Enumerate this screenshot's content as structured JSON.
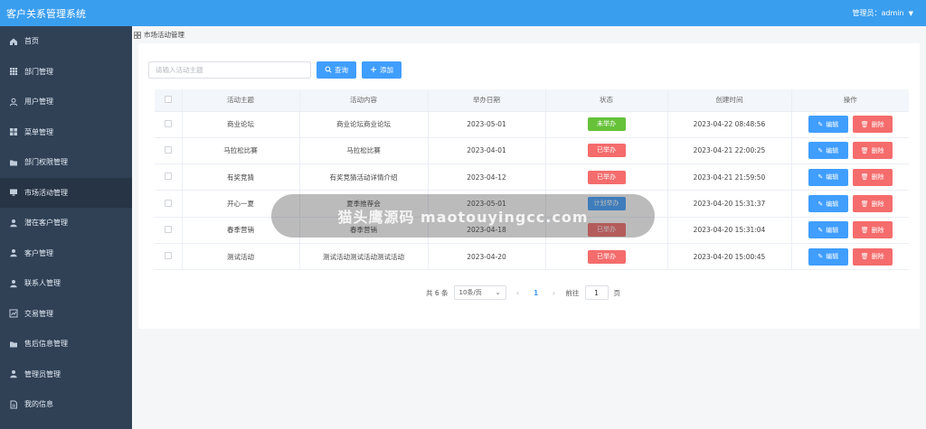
{
  "app": {
    "title": "客户关系管理系统",
    "admin_label": "管理员：admin"
  },
  "sidebar": {
    "items": [
      {
        "label": "首页",
        "icon": "home-icon"
      },
      {
        "label": "部门管理",
        "icon": "grid-icon"
      },
      {
        "label": "用户管理",
        "icon": "user-icon"
      },
      {
        "label": "菜单管理",
        "icon": "menu-grid-icon"
      },
      {
        "label": "部门权限管理",
        "icon": "folder-icon"
      },
      {
        "label": "市场活动管理",
        "icon": "computer-icon"
      },
      {
        "label": "潜在客户管理",
        "icon": "person-icon"
      },
      {
        "label": "客户管理",
        "icon": "person-icon"
      },
      {
        "label": "联系人管理",
        "icon": "person-icon"
      },
      {
        "label": "交易管理",
        "icon": "chart-icon"
      },
      {
        "label": "售后信息管理",
        "icon": "folder-icon"
      },
      {
        "label": "管理员管理",
        "icon": "person-icon"
      },
      {
        "label": "我的信息",
        "icon": "document-icon"
      }
    ]
  },
  "breadcrumb": {
    "label": "市场活动管理"
  },
  "search": {
    "placeholder": "请输入活动主题",
    "value": ""
  },
  "toolbar": {
    "query_label": "查询",
    "add_label": "添加"
  },
  "table": {
    "headers": [
      "活动主题",
      "活动内容",
      "举办日期",
      "状态",
      "创建时间",
      "操作"
    ],
    "rows": [
      {
        "theme": "商业论坛",
        "content": "商业论坛商业论坛",
        "date": "2023-05-01",
        "status": "未举办",
        "created": "2023-04-22 08:48:56"
      },
      {
        "theme": "马拉松比赛",
        "content": "马拉松比赛",
        "date": "2023-04-01",
        "status": "已举办",
        "created": "2023-04-21 22:00:25"
      },
      {
        "theme": "有奖竞猜",
        "content": "有奖竞猜活动详情介绍",
        "date": "2023-04-12",
        "status": "已举办",
        "created": "2023-04-21 21:59:50"
      },
      {
        "theme": "开心一夏",
        "content": "夏季推荐会",
        "date": "2023-05-01",
        "status": "计划举办",
        "created": "2023-04-20 15:31:37"
      },
      {
        "theme": "春季营销",
        "content": "春季营销",
        "date": "2023-04-18",
        "status": "已举办",
        "created": "2023-04-20 15:31:04"
      },
      {
        "theme": "测试活动",
        "content": "测试活动测试活动测试活动",
        "date": "2023-04-20",
        "status": "已举办",
        "created": "2023-04-20 15:00:45"
      }
    ],
    "edit_label": "编辑",
    "delete_label": "删除"
  },
  "pager": {
    "total": "共 6 条",
    "page_size": "10条/页",
    "current": "1",
    "goto_label": "前往",
    "goto_value": "1",
    "page_suffix": "页"
  },
  "watermark": {
    "text": "猫头鹰源码 maotouyingcc.com"
  },
  "colors": {
    "topbar": "#3a9eef",
    "sidebar": "#304156",
    "primary": "#409eff",
    "danger": "#f56c6c",
    "success": "#67c23a"
  }
}
